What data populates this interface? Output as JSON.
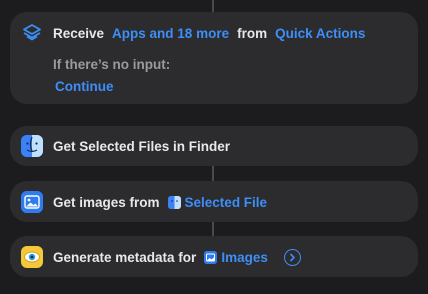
{
  "receive": {
    "label": "Receive",
    "types": "Apps and 18 more",
    "from": "from",
    "source": "Quick Actions",
    "no_input_label": "If there’s no input:",
    "no_input_action": "Continue",
    "icon": "shortcuts-layers-icon"
  },
  "actions": [
    {
      "label": "Get Selected Files in Finder",
      "icon": "finder-icon"
    },
    {
      "label": "Get images from",
      "param": "Selected File",
      "param_icon": "finder-icon",
      "icon": "image-icon"
    },
    {
      "label": "Generate metadata for",
      "param": "Images",
      "param_icon": "image-icon",
      "icon": "eye-icon",
      "expand_icon": "chevron-right-circle-icon"
    }
  ],
  "colors": {
    "background": "#1c1c1e",
    "card": "#2c2c2e",
    "accent": "#3d8ef8",
    "text": "#e8e8ea",
    "muted": "#9a9aa0"
  }
}
